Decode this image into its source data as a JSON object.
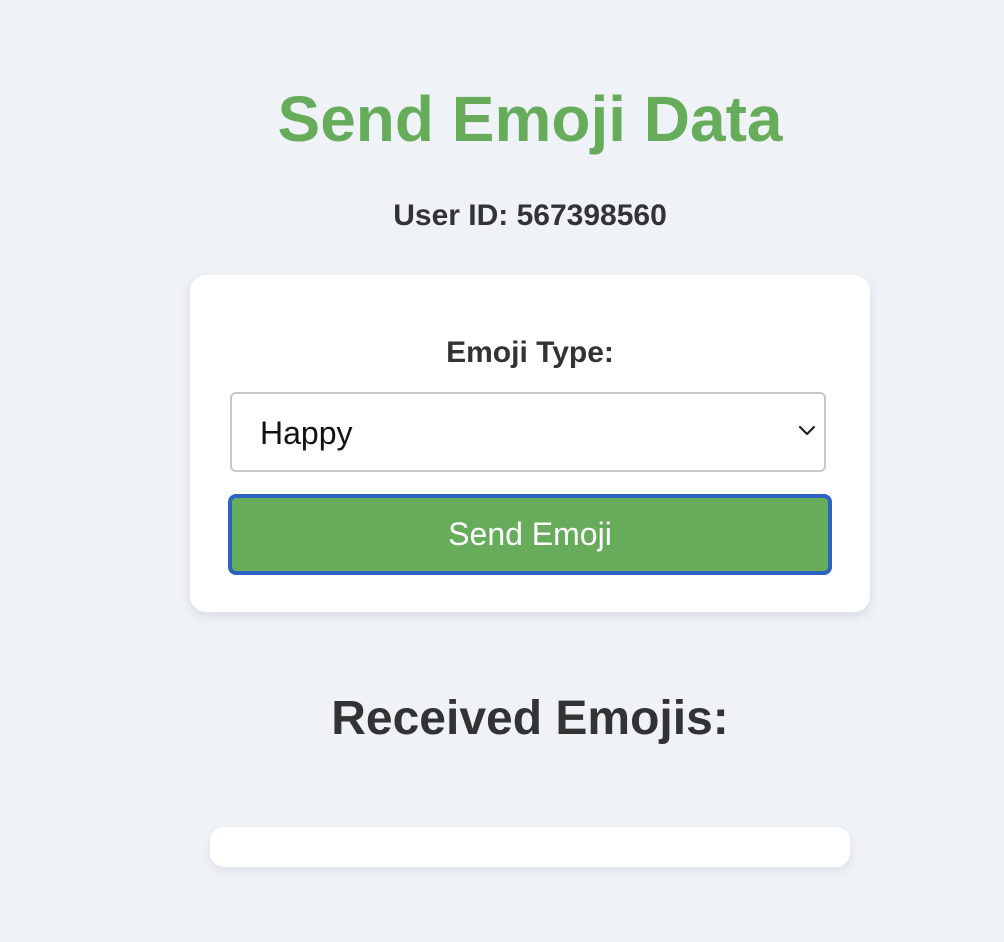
{
  "page": {
    "title": "Send Emoji Data",
    "user_id_text": "User ID: 567398560"
  },
  "form": {
    "emoji_type_label": "Emoji Type:",
    "selected_emoji_type": "Happy",
    "send_button_label": "Send Emoji"
  },
  "received": {
    "title": "Received Emojis:",
    "items": []
  },
  "colors": {
    "accent_green": "#67ac5b",
    "focus_blue": "#2c62c2",
    "background": "#eff3f8"
  },
  "icons": {
    "select_arrow": "chevron-down-icon"
  }
}
